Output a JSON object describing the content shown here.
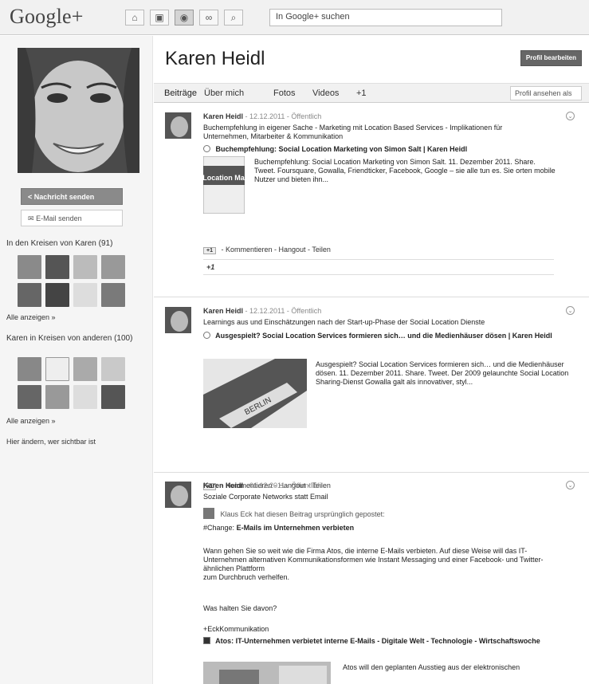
{
  "topbar": {
    "logo": "Google+",
    "nav_icons": [
      "home-icon",
      "photos-icon",
      "profile-icon",
      "circles-icon",
      "games-icon"
    ],
    "search_placeholder": "In Google+ suchen"
  },
  "sidebar": {
    "send_message": "Nachricht senden",
    "send_email": "E-Mail senden",
    "in_circles_title": "In den Kreisen von Karen (91)",
    "show_all_1": "Alle anzeigen »",
    "in_others_title": "Karen in Kreisen von anderen (100)",
    "show_all_2": "Alle anzeigen »",
    "change_visibility": "Hier ändern, wer sichtbar ist"
  },
  "profile": {
    "name": "Karen Heidl",
    "edit_button": "Profil bearbeiten",
    "view_as": "Profil ansehen als",
    "tabs": [
      "Beiträge",
      "Über mich",
      "Fotos",
      "Videos",
      "+1"
    ]
  },
  "posts": [
    {
      "author": "Karen Heidl",
      "date": "12.12.2011",
      "visibility": "Öffentlich",
      "text": "Buchempfehlung in eigener Sache - Marketing mit Location Based Services - Implikationen für Unternehmen, Mitarbeiter & Kommunikation",
      "link_title": "Buchempfehlung: Social Location Marketing von Simon Salt | Karen Heidl",
      "link_desc": "Buchempfehlung: Social Location Marketing von Simon Salt. 11. Dezember 2011. Share. Tweet. Foursquare, Gowalla, Friendticker, Facebook, Google – sie alle tun es. Sie orten mobile Nutzer und bieten ihn...",
      "image_caption": "Social Location Marketing",
      "actions": [
        "+1",
        "Kommentieren",
        "Hangout",
        "Teilen"
      ],
      "plus_one_box": "+1"
    },
    {
      "author": "Karen Heidl",
      "date": "12.12.2011",
      "visibility": "Öffentlich",
      "text": "Learnings aus und Einschätzungen nach der Start-up-Phase der Social Location Dienste",
      "link_title": "Ausgespielt? Social Location Services formieren sich… und die Medienhäuser dösen | Karen Heidl",
      "link_desc": "Ausgespielt? Social Location Services formieren sich… und die Medienhäuser dösen. 11. Dezember 2011. Share. Tweet. Der 2009 gelaunchte Social Location Sharing-Dienst Gowalla galt als innovativer, styl...",
      "image_caption": "BERLIN",
      "actions": [
        "+1",
        "Kommentieren",
        "Hangout",
        "Teilen"
      ]
    },
    {
      "author": "Karen Heidl",
      "date": "01.12.2011",
      "visibility": "Öffentlich",
      "text": "Soziale Corporate Networks statt Email",
      "reshare_author": "Klaus Eck",
      "reshare_note": "hat diesen Beitrag ursprünglich gepostet:",
      "hashtag": "#Change:",
      "headline": "E-Mails im Unternehmen verbieten",
      "body_1": "Wann gehen Sie so weit wie die Firma Atos, die interne E-Mails verbieten. Auf diese Weise will das IT-Unternehmen alternativen Kommunikationsformen wie Instant Messaging und einer Facebook- und Twitter-ähnlichen Plattform",
      "body_2": "zum Durchbruch verhelfen.",
      "question": "Was halten Sie davon?",
      "tag": "+EckKommunikation",
      "link_title": "Atos: IT-Unternehmen verbietet interne E-Mails - Digitale Welt - Technologie - Wirtschaftswoche",
      "link_desc": "Atos will den geplanten Ausstieg aus der elektronischen"
    }
  ]
}
